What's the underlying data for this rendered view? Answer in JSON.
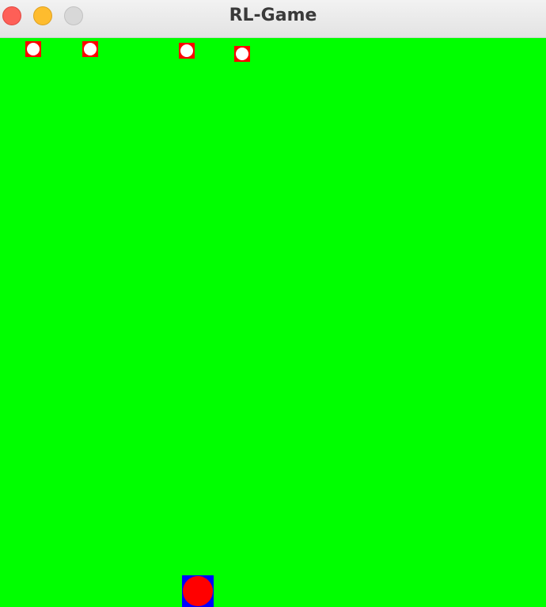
{
  "window": {
    "title": "RL-Game"
  },
  "colors": {
    "background": "#00ff00",
    "enemy_square": "#ff0000",
    "enemy_core": "#ffffff",
    "player_square": "#0000ff",
    "player_core": "#ff0000"
  },
  "entities": {
    "enemy_count": 4,
    "player_count": 1
  }
}
